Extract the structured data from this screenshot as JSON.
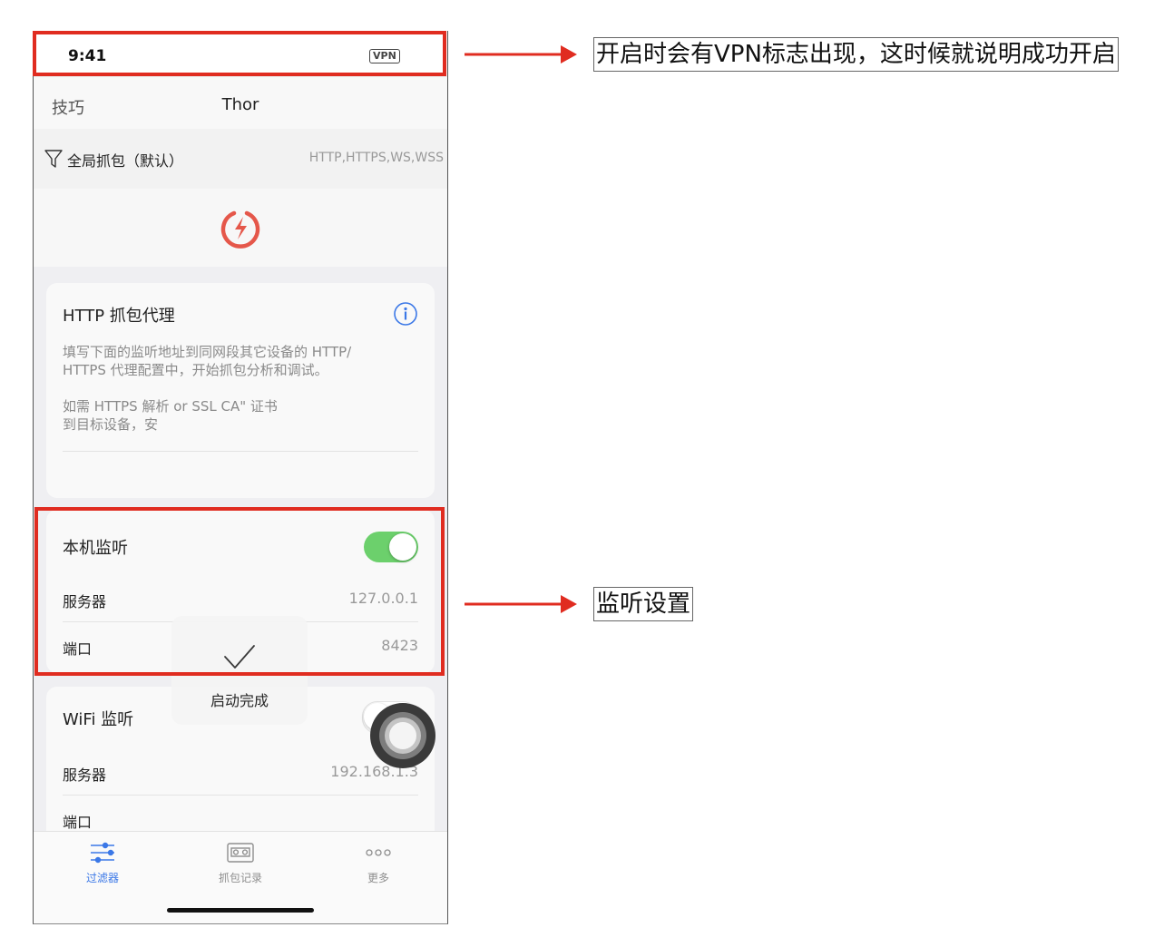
{
  "status_bar": {
    "time": "9:41",
    "vpn_badge": "VPN"
  },
  "nav": {
    "left_label": "技巧",
    "title": "Thor"
  },
  "filter": {
    "label": "全局抓包（默认）",
    "protocols": "HTTP,HTTPS,WS,WSS",
    "icon": "funnel-icon"
  },
  "logo": {
    "icon": "thor-power-logo",
    "color": "#e5574a"
  },
  "proxy_card": {
    "title": "HTTP 抓包代理",
    "desc1": "填写下面的监听地址到同网段其它设备的 HTTP/\nHTTPS 代理配置中，开始抓包分析和调试。",
    "desc2": "如需 HTTPS 解析                                  or SSL CA\" 证书\n到目标设备，安"
  },
  "toast": {
    "text": "启动完成",
    "icon": "checkmark-icon"
  },
  "local_listen": {
    "title": "本机监听",
    "enabled": true,
    "server_label": "服务器",
    "server_value": "127.0.0.1",
    "port_label": "端口",
    "port_value": "8423"
  },
  "wifi_listen": {
    "title": "WiFi 监听",
    "enabled": false,
    "server_label": "服务器",
    "server_value": "192.168.1.3",
    "port_label": "端口"
  },
  "tabs": [
    {
      "label": "过滤器",
      "icon": "sliders-icon",
      "active": true
    },
    {
      "label": "抓包记录",
      "icon": "cassette-icon",
      "active": false
    },
    {
      "label": "更多",
      "icon": "more-dots-icon",
      "active": false
    }
  ],
  "annotations": {
    "vpn_note": "开启时会有VPN标志出现，这时候就说明成功开启",
    "listen_note": "监听设置",
    "highlight_color": "#e02c20"
  },
  "colors": {
    "accent": "#3b78e7",
    "toggle_on": "#6cd06c"
  }
}
